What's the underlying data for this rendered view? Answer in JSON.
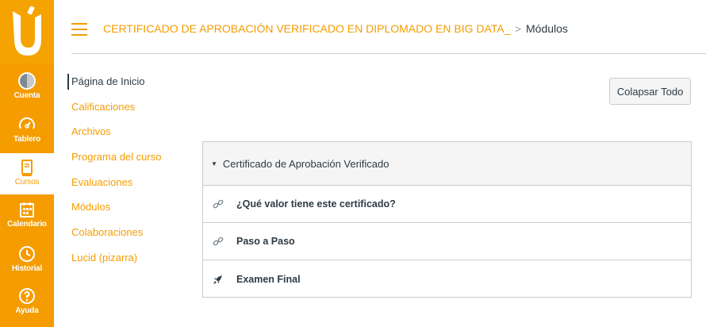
{
  "global_nav": {
    "items": [
      {
        "label": "Cuenta",
        "icon": "account-avatar-icon"
      },
      {
        "label": "Tablero",
        "icon": "dashboard-gauge-icon"
      },
      {
        "label": "Cursos",
        "icon": "book-icon"
      },
      {
        "label": "Calendario",
        "icon": "calendar-icon"
      },
      {
        "label": "Historial",
        "icon": "clock-icon"
      },
      {
        "label": "Ayuda",
        "icon": "help-icon"
      }
    ],
    "active_index": 2
  },
  "header": {
    "course_title": "CERTIFICADO DE APROBACIÓN VERIFICADO EN DIPLOMADO EN BIG DATA_",
    "separator": ">",
    "current_page": "Módulos"
  },
  "course_nav": {
    "items": [
      "Página de Inicio",
      "Calificaciones",
      "Archivos",
      "Programa del curso",
      "Evaluaciones",
      "Módulos",
      "Colaboraciones",
      "Lucid (pizarra)"
    ],
    "active_index": 0
  },
  "toolbar": {
    "collapse_label": "Colapsar Todo"
  },
  "module": {
    "title": "Certificado de Aprobación Verificado",
    "items": [
      {
        "title": "¿Qué valor tiene este certificado?",
        "icon": "link-icon"
      },
      {
        "title": "Paso a Paso",
        "icon": "link-icon"
      },
      {
        "title": "Examen Final",
        "icon": "quiz-rocket-icon"
      }
    ]
  },
  "colors": {
    "brand": "#f59c00",
    "text": "#2d3b45",
    "border": "#c7cdd1"
  }
}
